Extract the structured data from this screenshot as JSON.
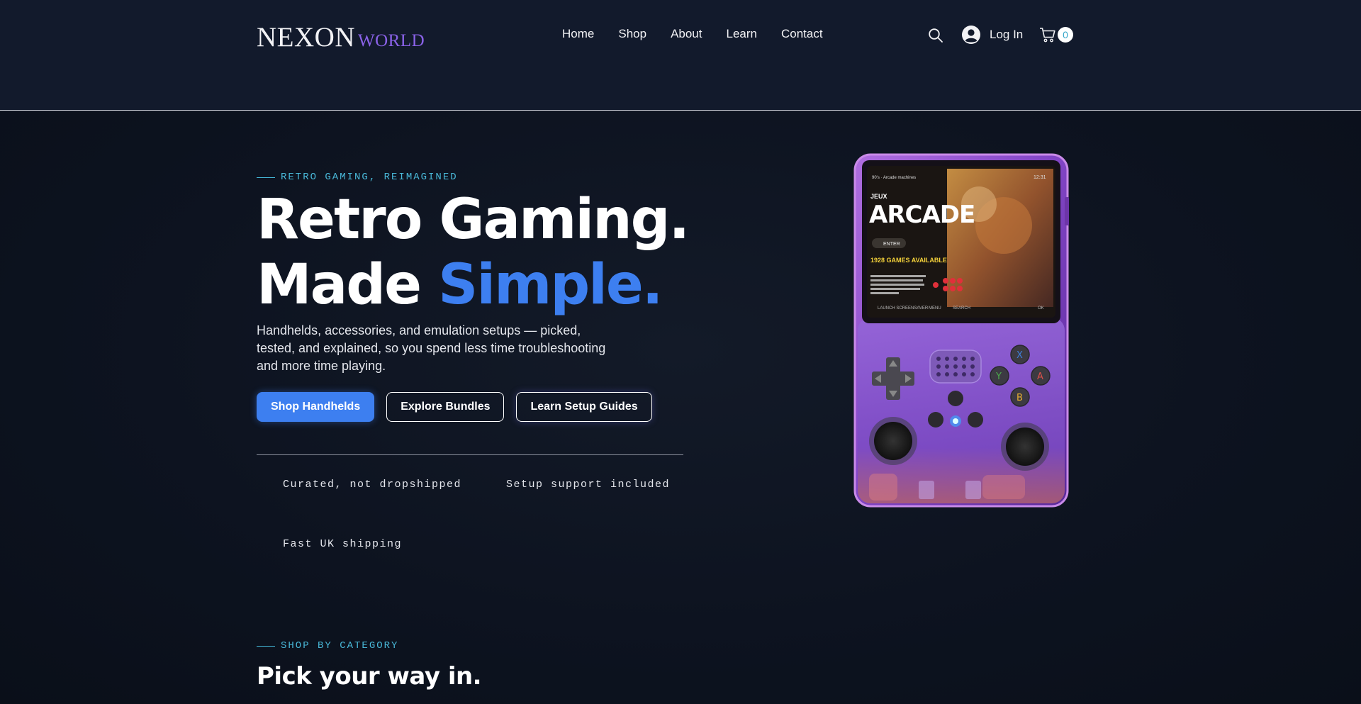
{
  "header": {
    "logo_main": "NEXON",
    "logo_sub": "WORLD",
    "nav": [
      {
        "label": "Home"
      },
      {
        "label": "Shop"
      },
      {
        "label": "About"
      },
      {
        "label": "Learn"
      },
      {
        "label": "Contact"
      }
    ],
    "login_label": "Log In",
    "cart_count": "0"
  },
  "hero": {
    "eyebrow": "RETRO GAMING, REIMAGINED",
    "title_line1": "Retro Gaming.",
    "title_line2_plain": "Made ",
    "title_line2_accent": "Simple.",
    "description": "Handhelds, accessories, and emulation setups — picked, tested, and explained, so you spend less time troubleshooting and more time playing.",
    "buttons": {
      "shop": "Shop Handhelds",
      "bundles": "Explore Bundles",
      "guides": "Learn Setup Guides"
    },
    "features": [
      "Curated, not dropshipped",
      "Setup support included",
      "Fast UK shipping"
    ]
  },
  "device_screen": {
    "top_left": "90's · Arcade machines",
    "clock": "12:31",
    "small_title": "JEUX",
    "big_title": "ARCADE",
    "enter": "ENTER",
    "games_available": "1928 GAMES AVAILABLE",
    "blurb": "Coin-operated entertainment machines. The golden age is defined as a period between the late 1970s and ending in the mid-1980s",
    "footer_left": "LAUNCH SCREENSAVER",
    "footer_menu": "MENU",
    "footer_search": "SEARCH",
    "footer_ok": "OK"
  },
  "category_section": {
    "eyebrow": "SHOP BY CATEGORY",
    "title": "Pick your way in."
  },
  "colors": {
    "accent_blue": "#3d7ff0",
    "eyebrow_cyan": "#49b8d8",
    "logo_purple": "#8a62e8",
    "header_bg": "#121a2c",
    "device_purple": "#8a4fd0"
  },
  "icons": [
    "search-icon",
    "user-avatar-icon",
    "cart-icon"
  ]
}
